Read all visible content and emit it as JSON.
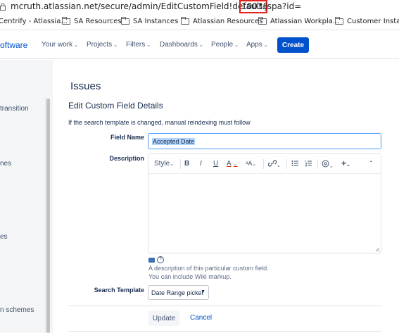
{
  "browser": {
    "url_prefix": "mcruth.atlassian.net/secure/admin/EditCustomField!default.jspa?id=",
    "url_id": "10036",
    "bookmarks": [
      "Centrify - Atlassia...",
      "SA Resources",
      "SA Instances",
      "Atlassian Resources",
      "Atlassian Workpla...",
      "Customer Instance"
    ]
  },
  "header": {
    "brand": "oftware",
    "nav": [
      "Your work",
      "Projects",
      "Filters",
      "Dashboards",
      "People",
      "Apps"
    ],
    "create_label": "Create"
  },
  "sidebar": {
    "items": [
      "transition",
      "nes",
      "es",
      "n schemes"
    ]
  },
  "main": {
    "page_title": "Issues",
    "section_title": "Edit Custom Field Details",
    "hint": "If the search template is changed, manual reindexing must follow",
    "field_name_label": "Field Name",
    "field_name_value": "Accepted Date",
    "description_label": "Description",
    "toolbar": {
      "style_label": "Style",
      "bold": "B",
      "italic": "I",
      "underline": "U",
      "text_color": "A",
      "more_format": "ᵃA"
    },
    "description_help_1": "A description of this particular custom field.",
    "description_help_2": "You can include Wiki markup.",
    "search_template_label": "Search Template",
    "search_template_value": "Date Range picker",
    "update_label": "Update",
    "cancel_label": "Cancel"
  },
  "colors": {
    "primary": "#0052cc",
    "highlight_box": "#e0201b",
    "selection": "#b3d4fc"
  }
}
